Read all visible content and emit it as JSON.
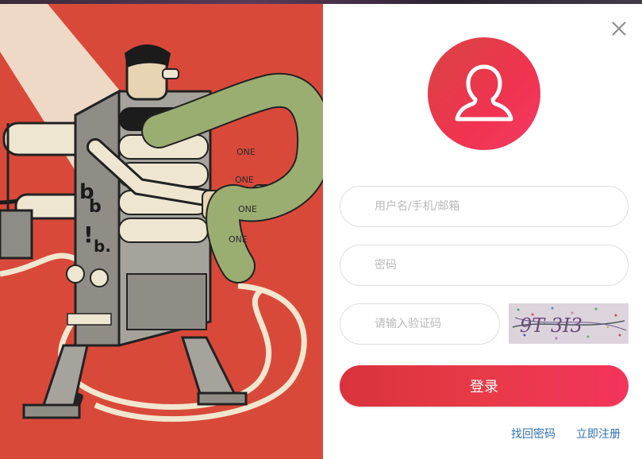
{
  "form": {
    "username_placeholder": "用户名/手机/邮箱",
    "password_placeholder": "密码",
    "captcha_placeholder": "请输入验证码",
    "captcha_text": "9T 3I3",
    "login_label": "登录"
  },
  "links": {
    "forgot_password": "找回密码",
    "register": "立即注册"
  },
  "illustration": {
    "ticker_text": "ONE"
  },
  "colors": {
    "accent": "#ef3652",
    "link": "#2f6fb6",
    "art_background": "#d9493a"
  },
  "icons": {
    "close": "close-icon",
    "avatar": "user-silhouette-icon"
  }
}
